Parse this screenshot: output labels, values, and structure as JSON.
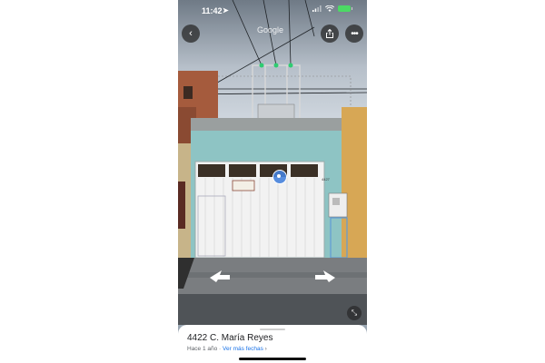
{
  "status_bar": {
    "time": "11:42",
    "location_icon": "location-arrow-icon",
    "battery_color": "#4cd964"
  },
  "toolbar": {
    "back_icon": "chevron-left-icon",
    "share_icon": "share-icon",
    "more_icon": "more-dots-icon",
    "watermark": "Google"
  },
  "street_view": {
    "house_number": "4427",
    "sign_text": "",
    "pin_icon": "location-pin-icon",
    "left_arrow_icon": "arrow-left-icon",
    "right_arrow_icon": "arrow-right-icon",
    "collapse_icon": "collapse-icon"
  },
  "place_card": {
    "title": "4422 C. María Reyes",
    "age": "Hace 1 año",
    "separator": " · ",
    "more_dates_label": "Ver más fechas",
    "chevron": "›"
  }
}
